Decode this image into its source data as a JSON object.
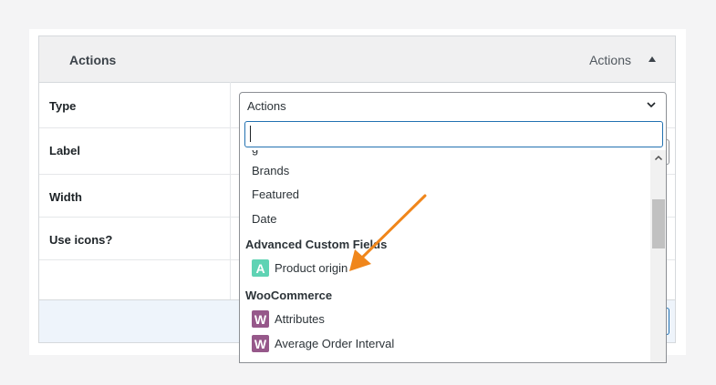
{
  "panel": {
    "title": "Actions",
    "header_right": "Actions"
  },
  "rows": [
    {
      "label": "Type"
    },
    {
      "label": "Label"
    },
    {
      "label": "Width"
    },
    {
      "label": "Use icons?"
    }
  ],
  "select": {
    "value": "Actions"
  },
  "dropdown": {
    "search_value": "",
    "items": [
      {
        "type": "option",
        "label": "Brands"
      },
      {
        "type": "option",
        "label": "Featured"
      },
      {
        "type": "option",
        "label": "Date"
      },
      {
        "type": "group",
        "label": "Advanced Custom Fields"
      },
      {
        "type": "option",
        "label": "Product origin",
        "icon": "acf-icon",
        "icon_char": "A",
        "icon_color": "#5fd3b4"
      },
      {
        "type": "group",
        "label": "WooCommerce"
      },
      {
        "type": "option",
        "label": "Attributes",
        "icon": "woocommerce-icon",
        "icon_char": "W",
        "icon_color": "#96588a"
      },
      {
        "type": "option",
        "label": "Average Order Interval",
        "icon": "woocommerce-icon",
        "icon_char": "W",
        "icon_color": "#96588a"
      }
    ]
  },
  "annotation": {
    "arrow_color": "#f0861b"
  }
}
